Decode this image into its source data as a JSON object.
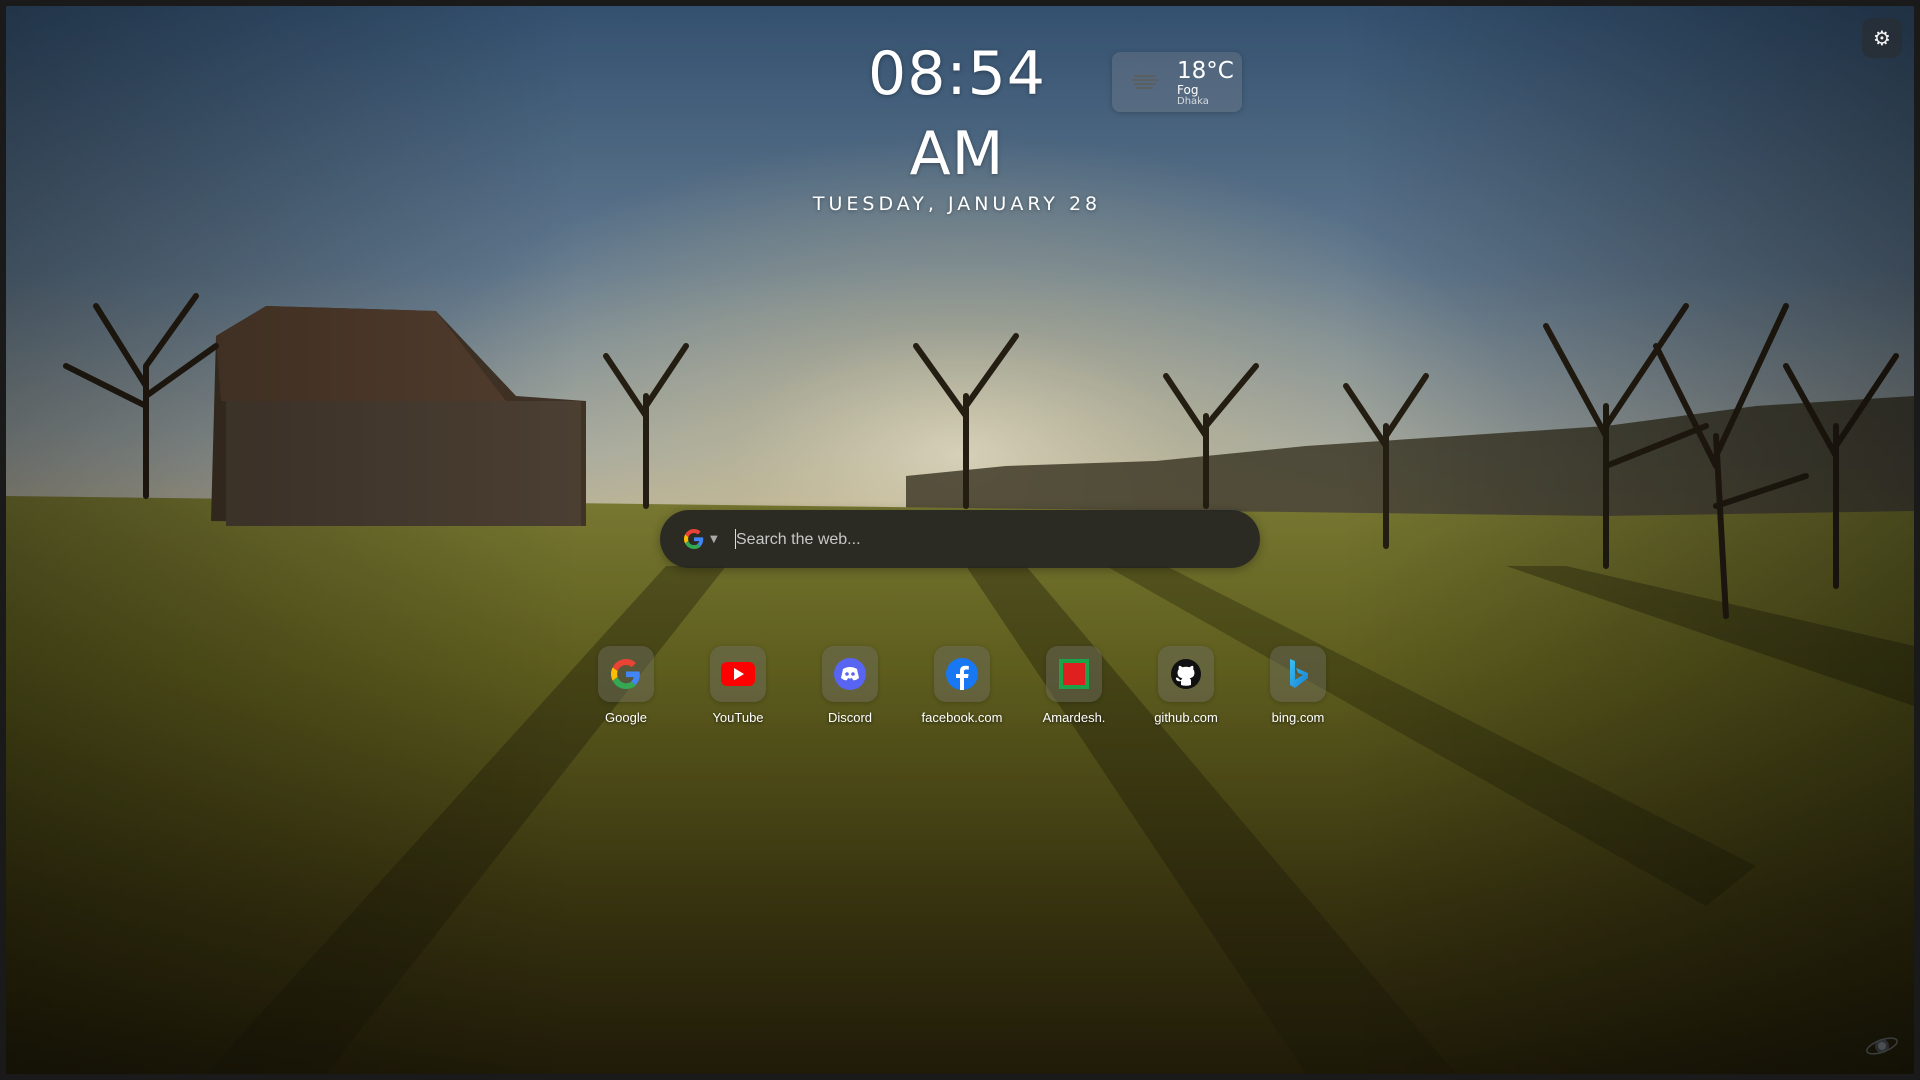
{
  "clock": {
    "time": "08:54 AM",
    "date": "TUESDAY, JANUARY 28"
  },
  "weather": {
    "temperature": "18°C",
    "condition": "Fog",
    "city": "Dhaka",
    "icon": "fog-icon"
  },
  "settings": {
    "icon": "gear-icon",
    "glyph": "⚙"
  },
  "search": {
    "engine_icon": "google-icon",
    "placeholder": "Search the web...",
    "value": ""
  },
  "shortcuts": [
    {
      "label": "Google",
      "icon": "google-icon"
    },
    {
      "label": "YouTube",
      "icon": "youtube-icon"
    },
    {
      "label": "Discord",
      "icon": "discord-icon"
    },
    {
      "label": "facebook.com",
      "icon": "facebook-icon"
    },
    {
      "label": "Amardesh.",
      "icon": "amardesh-icon"
    },
    {
      "label": "github.com",
      "icon": "github-icon"
    },
    {
      "label": "bing.com",
      "icon": "bing-icon"
    }
  ],
  "colors": {
    "youtube": "#FF0000",
    "discord": "#5865F2",
    "facebook": "#1877F2",
    "amardesh_border": "#1DA24A",
    "amardesh_fill": "#E0201E",
    "bing": "#1FA6E0"
  }
}
